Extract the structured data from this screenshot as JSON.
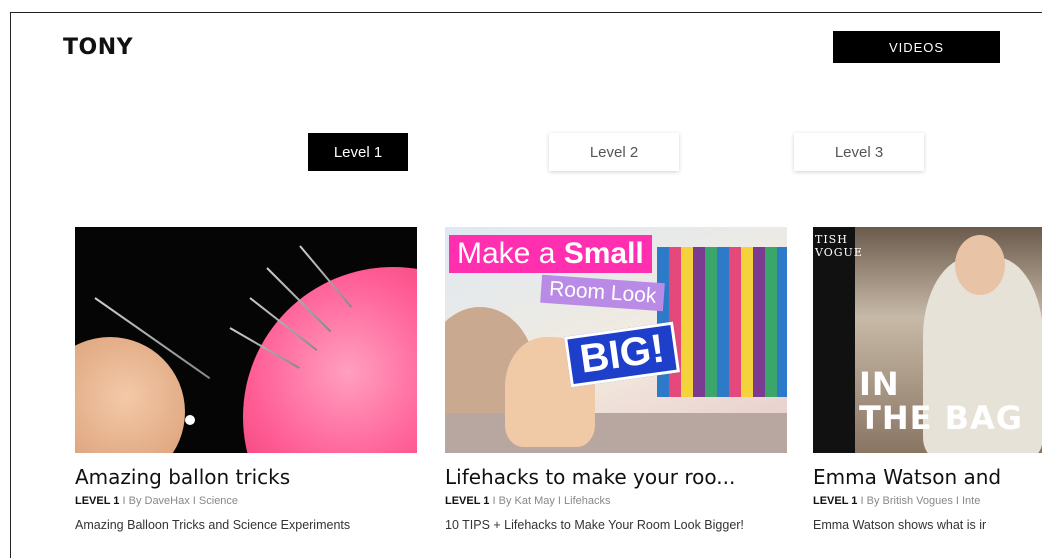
{
  "header": {
    "logo": "TONY",
    "videos_label": "VIDEOS"
  },
  "tabs": [
    {
      "label": "Level 1",
      "active": true
    },
    {
      "label": "Level 2",
      "active": false
    },
    {
      "label": "Level 3",
      "active": false
    }
  ],
  "cards": [
    {
      "title": "Amazing ballon tricks",
      "level": "LEVEL 1",
      "meta": " I By DaveHax I Science",
      "description": "Amazing Balloon Tricks and Science Experiments"
    },
    {
      "title": "Lifehacks to make your roo...",
      "level": "LEVEL 1",
      "meta": " I By Kat May I Lifehacks",
      "description": "10 TIPS + Lifehacks to Make Your Room Look Bigger!",
      "thumbnail_text": {
        "line1_prefix": "Make a ",
        "line1_bold": "Small",
        "line2": "Room Look",
        "line3": "BIG!"
      }
    },
    {
      "title": "Emma Watson and",
      "level": "LEVEL 1",
      "meta": " I By British Vogues I Inte",
      "description": "Emma Watson shows what is ir",
      "thumbnail_text": {
        "brand_vertical": "TISH VOGUE",
        "caption_line1": "IN",
        "caption_line2": "THE BAG"
      }
    }
  ],
  "colors": {
    "accent": "#000000",
    "background": "#ffffff"
  }
}
